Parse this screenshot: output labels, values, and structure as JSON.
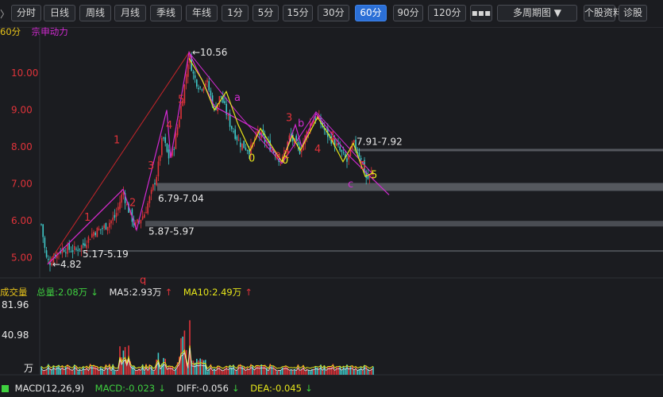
{
  "toolbar": {
    "nav_arrow": "〉",
    "buttons": [
      "分时",
      "日线",
      "周线",
      "月线",
      "季线",
      "年线",
      "1分",
      "5分",
      "15分",
      "30分",
      "60分",
      "90分",
      "120分",
      "▪▪▪",
      "多周期图 ▼",
      "个股资料",
      "诊股"
    ],
    "active": "60分"
  },
  "indicator_row": {
    "period": "60分",
    "indicator_name": "宗申动力"
  },
  "colors": {
    "up": "#e0333a",
    "down": "#3fc9c9",
    "wave_line": "#d12ad1",
    "trend_line": "#c7252a",
    "yellow_line": "#e6e61a",
    "background": "#1b1c20"
  },
  "chart_data": {
    "type": "candlestick",
    "y_ticks": [
      "10.00",
      "9.00",
      "8.00",
      "7.00",
      "6.00",
      "5.00"
    ],
    "ylim": [
      4.45,
      11.25
    ],
    "price_annotations": [
      {
        "id": "high",
        "text": "10.56"
      },
      {
        "id": "low",
        "text": "4.82"
      },
      {
        "id": "s1",
        "text": "5.17-5.19"
      },
      {
        "id": "s2",
        "text": "5.87-5.97"
      },
      {
        "id": "s3",
        "text": "6.79-7.04"
      },
      {
        "id": "s4",
        "text": "7.91-7.92"
      }
    ],
    "wave_labels_red": [
      "1",
      "2",
      "3",
      "4",
      "5",
      "1",
      "q"
    ],
    "wave_labels_magenta": [
      "a",
      "b",
      "c",
      "b",
      "c"
    ],
    "wave_labels_yellow": [
      "0",
      "0",
      "5"
    ],
    "wave_labels_extra": [
      "1",
      "2",
      "3",
      "4",
      "5",
      "a",
      "b",
      "c",
      "a"
    ],
    "zones": [
      {
        "from": 6.79,
        "to": 7.04
      },
      {
        "from": 5.87,
        "to": 5.97
      },
      {
        "from": 7.91,
        "to": 7.92
      },
      {
        "from": 5.17,
        "to": 5.19
      }
    ]
  },
  "volume": {
    "title": "成交量",
    "total_label": "总量:2.08万",
    "ma5_label": "MA5:2.93万",
    "ma10_label": "MA10:2.49万",
    "y_ticks": [
      "81.96",
      "40.98"
    ],
    "unit": "万"
  },
  "macd": {
    "title": "MACD(12,26,9)",
    "macd_label": "MACD:-0.023",
    "diff_label": "DIFF:-0.056",
    "dea_label": "DEA:-0.045"
  }
}
